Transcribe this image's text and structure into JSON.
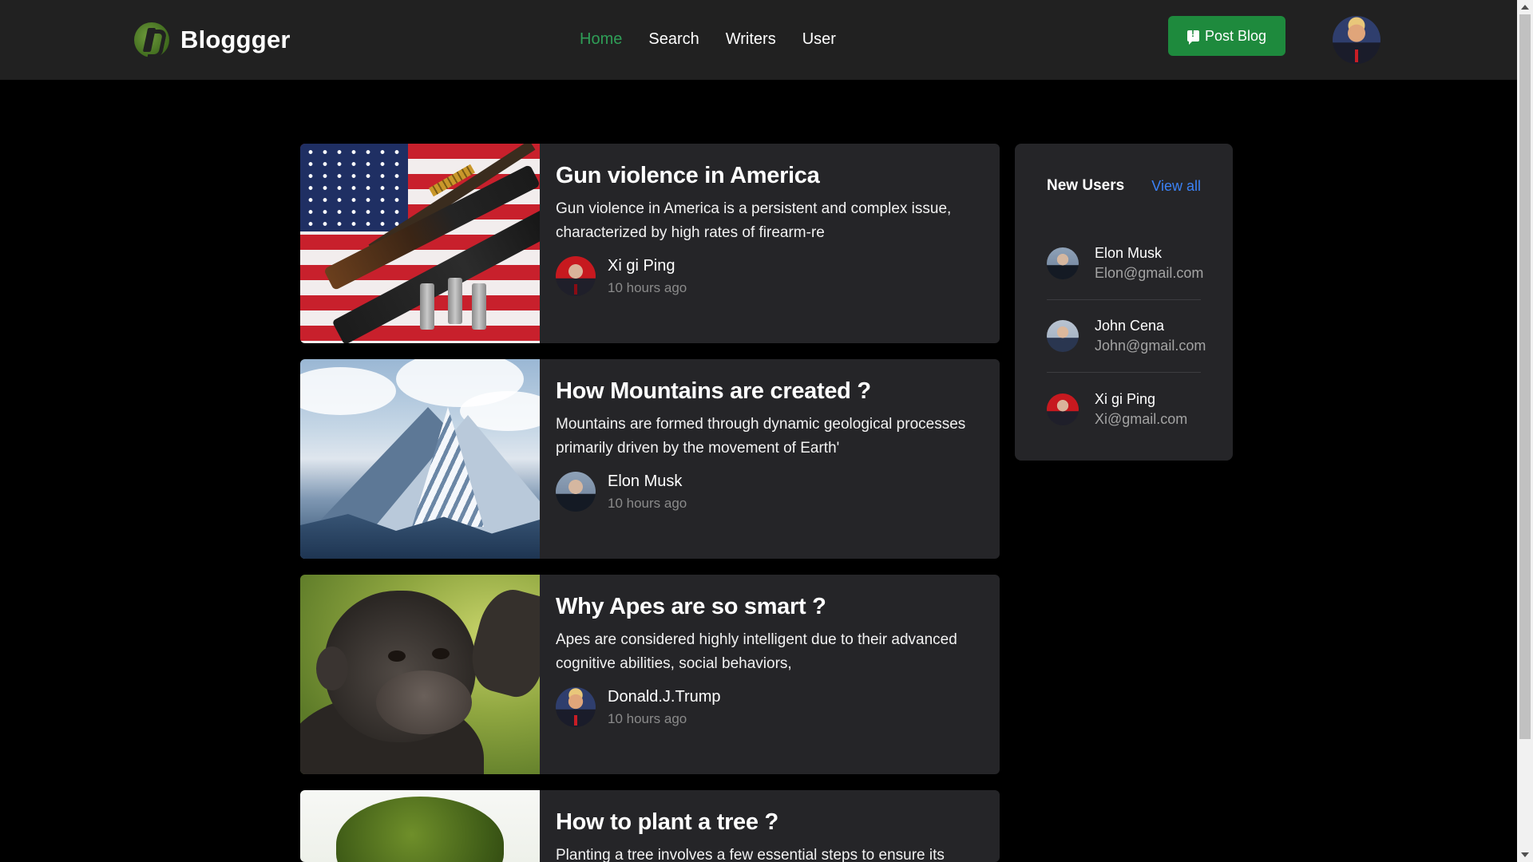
{
  "navbar": {
    "brand": "Bloggger",
    "links": [
      {
        "label": "Home",
        "active": true
      },
      {
        "label": "Search",
        "active": false
      },
      {
        "label": "Writers",
        "active": false
      },
      {
        "label": "User",
        "active": false
      }
    ],
    "post_button_label": "Post Blog",
    "accent_color": "#2f9e57",
    "button_color": "#1e8a3d"
  },
  "posts": [
    {
      "title": "Gun violence in America",
      "excerpt": "Gun violence in America is a persistent and complex issue, characterized by high rates of firearm-re",
      "author": "Xi gi Ping",
      "time": "10 hours ago",
      "image": "flag-and-guns"
    },
    {
      "title": "How Mountains are created ?",
      "excerpt": "Mountains are formed through dynamic geological processes primarily driven by the movement of Earth'",
      "author": "Elon Musk",
      "time": "10 hours ago",
      "image": "snowy-mountain"
    },
    {
      "title": "Why Apes are so smart ?",
      "excerpt": "Apes are considered highly intelligent due to their advanced cognitive abilities, social behaviors,",
      "author": "Donald.J.Trump",
      "time": "10 hours ago",
      "image": "young-ape"
    },
    {
      "title": "How to plant a tree ?",
      "excerpt": "Planting a tree involves a few essential steps to ensure its",
      "image": "green-tree"
    }
  ],
  "sidebar": {
    "title": "New Users",
    "view_all": "View all",
    "users": [
      {
        "name": "Elon Musk",
        "email": "Elon@gmail.com"
      },
      {
        "name": "John Cena",
        "email": "John@gmail.com"
      },
      {
        "name": "Xi gi Ping",
        "email": "Xi@gmail.com"
      }
    ],
    "link_color": "#3b82f6"
  }
}
